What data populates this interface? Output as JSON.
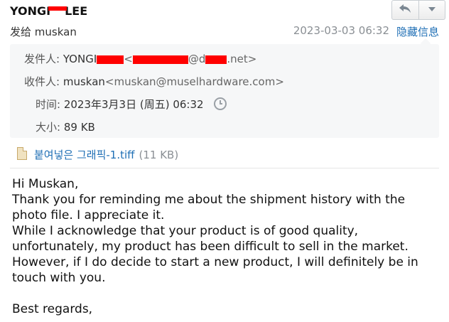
{
  "header": {
    "sender_part1": "YONGI",
    "sender_part2": "LEE",
    "to_label": "发给 muskan",
    "datetime": "2023-03-03 06:32",
    "hide_info": "隐藏信息"
  },
  "details": {
    "from_label": "发件人:",
    "from_name": "YONGI",
    "from_addr_mid": "@d",
    "from_addr_end": ".net>",
    "to_label": "收件人:",
    "to_name": "muskan",
    "to_addr": "<muskan@muselhardware.com>",
    "time_label": "时间:",
    "time_value": "2023年3月3日 (周五) 06:32",
    "size_label": "大小:",
    "size_value": "89 KB"
  },
  "attachment": {
    "name": "붙여넣은 그래픽-1.tiff",
    "size": "(11 KB)"
  },
  "message": {
    "greeting": "Hi Muskan,",
    "p1": "Thank you for reminding me about the shipment history with the photo file. I appreciate it.",
    "p2": "While I acknowledge that your product is of good quality, unfortunately, my product has been difficult to sell in the market. However, if I do decide to start a new product, I will definitely be in touch with you.",
    "closing": "Best regards,"
  },
  "icons": {
    "reply": "reply-icon",
    "more": "chevron-down-icon",
    "history": "clock-icon",
    "attachment": "file-icon"
  }
}
